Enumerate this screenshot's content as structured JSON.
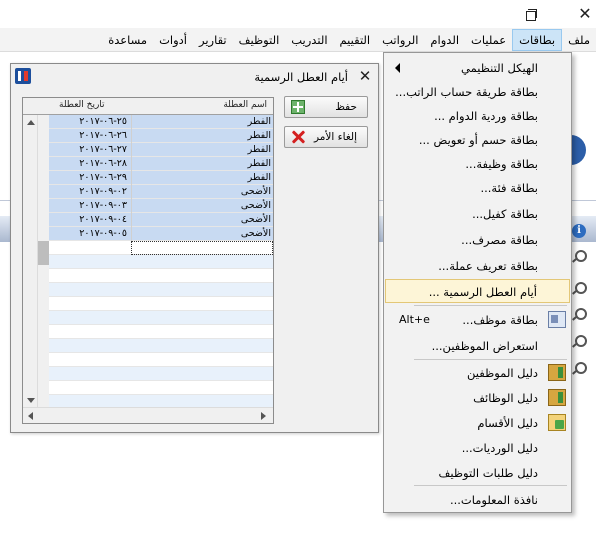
{
  "menubar": {
    "items": [
      "ملف",
      "بطاقات",
      "عمليات",
      "الدوام",
      "الرواتب",
      "التقييم",
      "التدريب",
      "التوظيف",
      "تقارير",
      "أدوات",
      "مساعدة"
    ],
    "active_index": 1
  },
  "dropdown": {
    "items": [
      {
        "label": "الهيكل التنظيمي",
        "shortcut": "",
        "submenu": true
      },
      {
        "label": "بطاقة طريقة حساب الراتب...",
        "shortcut": ""
      },
      {
        "label": "بطاقة وردية الدوام ...",
        "shortcut": ""
      },
      {
        "label": "بطاقة حسم أو تعويض ...",
        "shortcut": ""
      },
      {
        "label": "بطاقة وظيفة...",
        "shortcut": ""
      },
      {
        "label": "بطاقة فئة...",
        "shortcut": ""
      },
      {
        "label": "بطاقة كفيل...",
        "shortcut": ""
      },
      {
        "label": "بطاقة مصرف...",
        "shortcut": ""
      },
      {
        "label": "بطاقة تعريف عملة...",
        "shortcut": ""
      },
      {
        "label": "أيام العطل الرسمية ...",
        "shortcut": "",
        "highlighted": true
      },
      {
        "label": "بطاقة موظف...",
        "shortcut": "Alt+e",
        "icon": "employee-card-icon"
      },
      {
        "label": "استعراض الموظفين...",
        "shortcut": ""
      },
      {
        "label": "دليل الموظفين",
        "shortcut": "",
        "icon": "employees-guide-icon"
      },
      {
        "label": "دليل الوظائف",
        "shortcut": "",
        "icon": "jobs-guide-icon"
      },
      {
        "label": "دليل الأقسام",
        "shortcut": "",
        "icon": "departments-guide-icon"
      },
      {
        "label": "دليل الورديات...",
        "shortcut": ""
      },
      {
        "label": "دليل طلبات التوظيف",
        "shortcut": ""
      },
      {
        "label": "نافذة المعلومات...",
        "shortcut": ""
      }
    ]
  },
  "dialog": {
    "title": "أيام العطل الرسمية",
    "save_label": "حفظ",
    "cancel_label": "إلغاء الأمر",
    "columns": {
      "date": "تاريخ العطلة",
      "name": "اسم العطلة"
    },
    "rows": [
      {
        "date": "٢٥-٠٦-٢٠١٧",
        "name": "الفطر"
      },
      {
        "date": "٢٦-٠٦-٢٠١٧",
        "name": "الفطر"
      },
      {
        "date": "٢٧-٠٦-٢٠١٧",
        "name": "الفطر"
      },
      {
        "date": "٢٨-٠٦-٢٠١٧",
        "name": "الفطر"
      },
      {
        "date": "٢٩-٠٦-٢٠١٧",
        "name": "الفطر"
      },
      {
        "date": "٠٢-٠٩-٢٠١٧",
        "name": "الأضحى"
      },
      {
        "date": "٠٣-٠٩-٢٠١٧",
        "name": "الأضحى"
      },
      {
        "date": "٠٤-٠٩-٢٠١٧",
        "name": "الأضحى"
      },
      {
        "date": "٠٥-٠٩-٢٠١٧",
        "name": "الأضحى"
      }
    ]
  }
}
